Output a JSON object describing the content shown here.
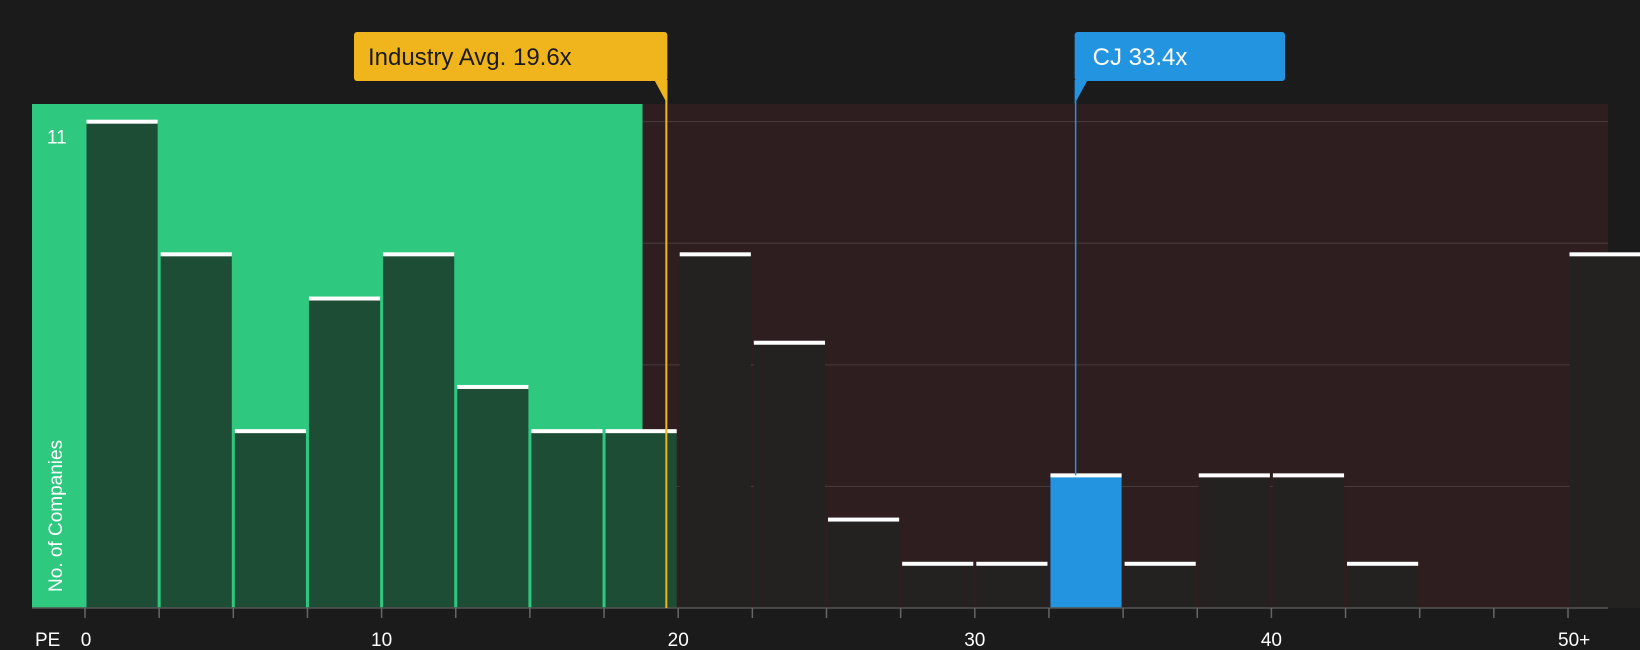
{
  "chart_data": {
    "type": "bar",
    "xlabel": "PE",
    "ylabel": "No. of Companies",
    "x_tick_labels": [
      "0",
      "10",
      "20",
      "30",
      "40",
      "50+"
    ],
    "x_tick_values": [
      0,
      10,
      20,
      30,
      40,
      50
    ],
    "xlim": [
      -1.8,
      51.3
    ],
    "ylim": [
      0,
      11.4
    ],
    "y_gridlines": [
      0,
      2.75,
      5.5,
      8.25,
      11
    ],
    "y_tick_labels": [
      {
        "label": "11",
        "value": 11
      }
    ],
    "bin_width": 2.5,
    "bars": [
      {
        "start": 0,
        "value": 11
      },
      {
        "start": 2.5,
        "value": 8
      },
      {
        "start": 5,
        "value": 4
      },
      {
        "start": 7.5,
        "value": 7
      },
      {
        "start": 10,
        "value": 8
      },
      {
        "start": 12.5,
        "value": 5
      },
      {
        "start": 15,
        "value": 4
      },
      {
        "start": 17.5,
        "value": 4
      },
      {
        "start": 20,
        "value": 8
      },
      {
        "start": 22.5,
        "value": 6
      },
      {
        "start": 25,
        "value": 2
      },
      {
        "start": 27.5,
        "value": 1
      },
      {
        "start": 30,
        "value": 1
      },
      {
        "start": 32.5,
        "value": 3,
        "highlight": true
      },
      {
        "start": 35,
        "value": 1
      },
      {
        "start": 37.5,
        "value": 3
      },
      {
        "start": 40,
        "value": 3
      },
      {
        "start": 42.5,
        "value": 1
      },
      {
        "start": 45,
        "value": 0
      },
      {
        "start": 47.5,
        "value": 0
      },
      {
        "start": 50,
        "value": 8
      }
    ],
    "shaded_region_end": 18.8,
    "industry_avg": {
      "value": 19.6,
      "label": "Industry Avg. 19.6x"
    },
    "company": {
      "value": 33.4,
      "label": "CJ 33.4x"
    },
    "colors": {
      "background": "#1b1b1b",
      "good_region": "#2ec97f",
      "bad_region": "#2e1e1f",
      "bar_good": "#1e4d35",
      "bar_bad": "#242121",
      "bar_highlight": "#2394e0",
      "bar_cap": "#ffffff",
      "industry": "#f0b41c",
      "company": "#2394e0",
      "gridline": "#4a3c3c"
    }
  }
}
